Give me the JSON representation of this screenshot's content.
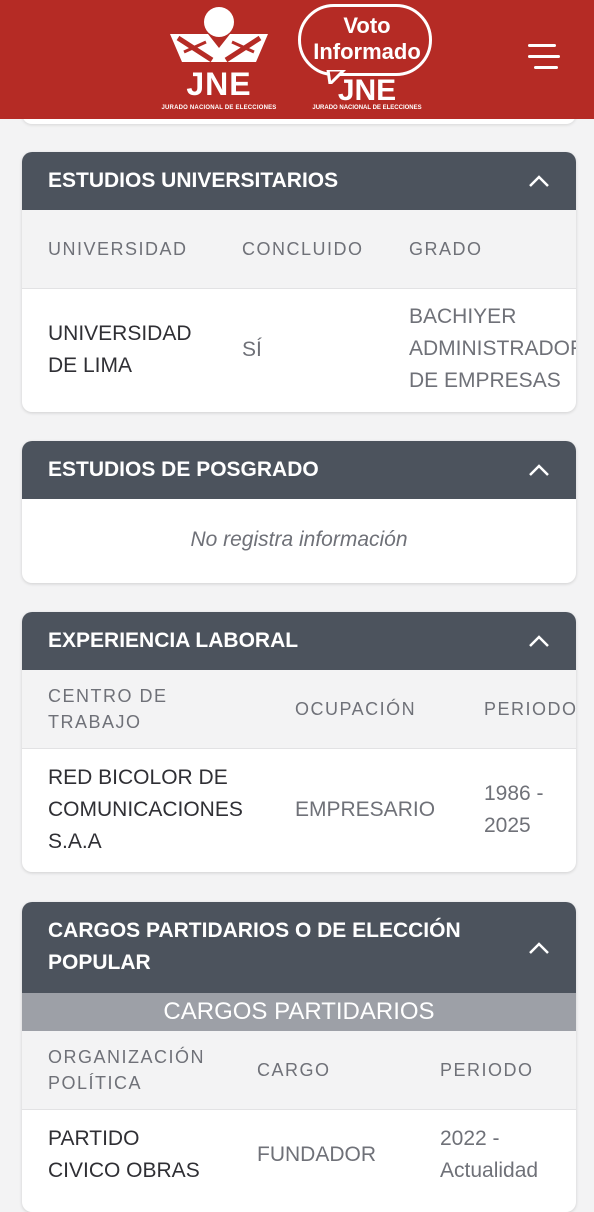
{
  "header": {
    "jne_logo": {
      "icon": "jne-emblem-icon",
      "text": "JNE",
      "subtext": "JURADO NACIONAL DE ELECCIONES"
    },
    "voto_logo": {
      "line1": "Voto",
      "line2": "Informado",
      "jne_text": "JNE",
      "subtext": "JURADO NACIONAL DE ELECCIONES"
    },
    "menu_icon": "hamburger-menu-icon",
    "color": "#b52b25"
  },
  "sections": {
    "universitarios": {
      "title": "ESTUDIOS UNIVERSITARIOS",
      "columns": [
        "UNIVERSIDAD",
        "CONCLUIDO",
        "GRADO"
      ],
      "row": {
        "universidad": [
          "UNIVERSIDAD",
          "DE LIMA"
        ],
        "concluido": "SÍ",
        "grado": [
          "BACHIYER",
          "ADMINISTRADOR",
          "DE EMPRESAS"
        ]
      }
    },
    "posgrado": {
      "title": "ESTUDIOS DE POSGRADO",
      "empty_text": "No registra información"
    },
    "laboral": {
      "title": "EXPERIENCIA LABORAL",
      "columns": [
        [
          "CENTRO DE",
          "TRABAJO"
        ],
        "OCUPACIÓN",
        "PERIODO"
      ],
      "row": {
        "centro": [
          "RED BICOLOR DE",
          "COMUNICACIONES",
          "S.A.A"
        ],
        "ocupacion": "EMPRESARIO",
        "periodo": [
          "1986 -",
          "2025"
        ]
      }
    },
    "cargos": {
      "title": [
        "CARGOS PARTIDARIOS O DE ELECCIÓN",
        "POPULAR"
      ],
      "subheader": "CARGOS PARTIDARIOS",
      "columns": [
        [
          "ORGANIZACIÓN",
          "POLÍTICA"
        ],
        "CARGO",
        "PERIODO"
      ],
      "row": {
        "organizacion": [
          "PARTIDO",
          "CIVICO OBRAS"
        ],
        "cargo": "FUNDADOR",
        "periodo": [
          "2022 -",
          "Actualidad"
        ]
      }
    }
  },
  "colors": {
    "card_header": "#4c535d",
    "subheader": "#9da0a7",
    "background": "#f3f3f4"
  }
}
